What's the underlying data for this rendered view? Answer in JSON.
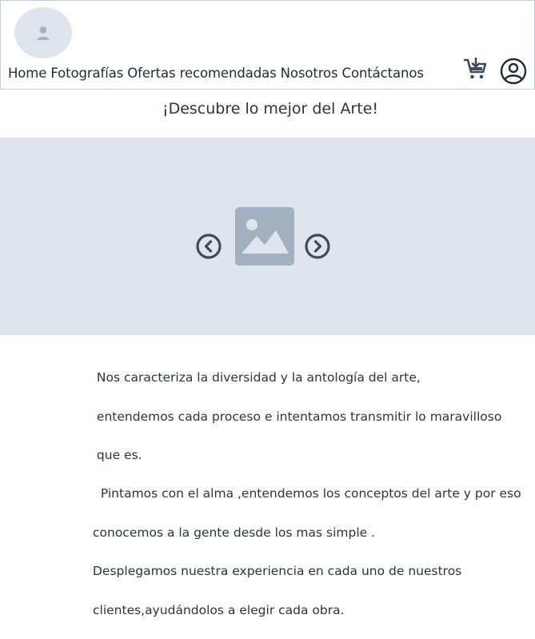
{
  "header": {
    "nav": [
      {
        "label": "Home"
      },
      {
        "label": "Fotografías"
      },
      {
        "label": "Ofertas recomendadas"
      },
      {
        "label": "Nosotros"
      },
      {
        "label": "Contáctanos"
      }
    ],
    "icons": {
      "avatar": "user-placeholder-icon",
      "cart": "cart-download-icon",
      "account": "account-circle-icon"
    }
  },
  "main": {
    "headline": "¡Descubre lo mejor del Arte!",
    "carousel": {
      "image_icon": "image-placeholder-icon",
      "prev_icon": "chevron-left-circle-icon",
      "next_icon": "chevron-right-circle-icon"
    },
    "paragraph_lines": [
      " Nos caracteriza la diversidad y la antología del arte,",
      " entendemos cada proceso e intentamos transmitir lo maravilloso",
      " que es.",
      "  Pintamos con el alma ,entendemos los conceptos del arte y por eso",
      "conocemos a la gente desde los mas simple .",
      "Desplegamos nuestra experiencia en cada uno de nuestros",
      "clientes,ayudándolos a elegir cada obra."
    ]
  },
  "colors": {
    "accent": "#3f4b5a",
    "placeholder_bg": "#dfe5ec",
    "placeholder_icon": "#a3b0bf",
    "border": "#c6ced8"
  }
}
